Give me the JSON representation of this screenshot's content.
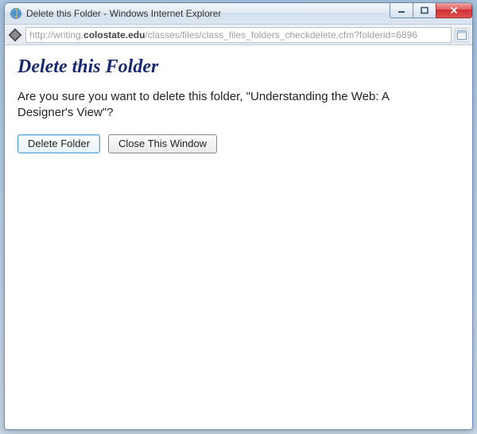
{
  "window": {
    "title": "Delete this Folder - Windows Internet Explorer"
  },
  "address": {
    "scheme": "http://",
    "subdomain": "writing.",
    "domain": "colostate.edu",
    "path": "/classes/files/class_files_folders_checkdelete.cfm?folderid=6896"
  },
  "page": {
    "heading": "Delete this Folder",
    "confirmation": "Are you sure you want to delete this folder, \"Understanding the Web: A Designer's View\"?",
    "buttons": {
      "delete": "Delete Folder",
      "close": "Close This Window"
    }
  }
}
